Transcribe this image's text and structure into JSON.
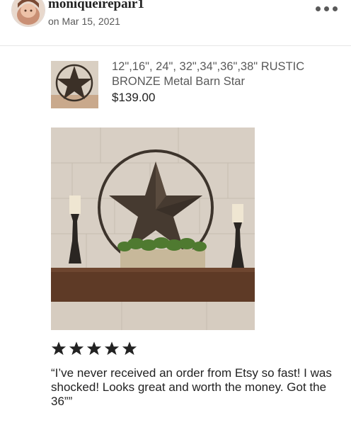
{
  "review": {
    "username": "moniqueirepair1",
    "date": "on Mar 15, 2021",
    "rating": 5,
    "text": "“I’ve never received an order from Etsy so fast! I was shocked! Looks great and worth the money. Got the 36””"
  },
  "product": {
    "title": "12\",16\", 24\", 32\",34\",36\",38\" RUSTIC BRONZE Metal Barn Star",
    "price": "$139.00"
  },
  "icons": {
    "more": "more-options-icon",
    "star": "star-icon"
  },
  "colors": {
    "star_fill": "#222222",
    "secondary_text": "#595959",
    "primary_text": "#222222"
  }
}
